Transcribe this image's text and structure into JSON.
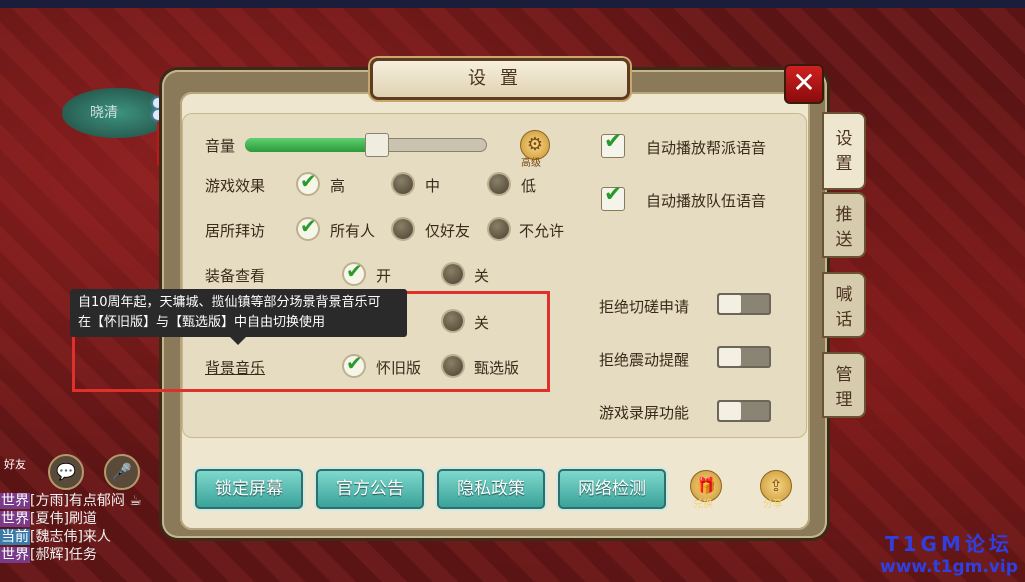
{
  "dialog": {
    "title": "设置",
    "close_label": "✕"
  },
  "left_map_label": "晓清",
  "tabs": [
    {
      "label_top": "设",
      "label_bottom": "置"
    },
    {
      "label_top": "推",
      "label_bottom": "送"
    },
    {
      "label_top": "喊",
      "label_bottom": "话"
    },
    {
      "label_top": "管",
      "label_bottom": "理"
    }
  ],
  "settings": {
    "volume": {
      "label": "音量",
      "level": 0.54
    },
    "advanced": {
      "label": "高级"
    },
    "game_effect": {
      "label": "游戏效果",
      "options": [
        "高",
        "中",
        "低"
      ],
      "selected": "高"
    },
    "home_visit": {
      "label": "居所拜访",
      "options": [
        "所有人",
        "仅好友",
        "不允许"
      ],
      "selected": "所有人"
    },
    "equipment_view": {
      "label": "装备查看",
      "options": [
        "开",
        "关"
      ],
      "selected": "开"
    },
    "hidden_row": {
      "options": [
        "开",
        "关"
      ],
      "selected": "开"
    },
    "bgm": {
      "label": "背景音乐",
      "options": [
        "怀旧版",
        "甄选版"
      ],
      "selected": "怀旧版"
    }
  },
  "right_settings": {
    "auto_guild_voice": {
      "label": "自动播放帮派语音",
      "checked": true
    },
    "auto_team_voice": {
      "label": "自动播放队伍语音",
      "checked": true
    },
    "reject_duel": {
      "label": "拒绝切磋申请",
      "on": false
    },
    "reject_vibrate": {
      "label": "拒绝震动提醒",
      "on": false
    },
    "screen_record": {
      "label": "游戏录屏功能",
      "on": false
    }
  },
  "tooltip": {
    "line1": "自10周年起，天墉城、揽仙镇等部分场景背景音乐可",
    "line2": "在【怀旧版】与【甄选版】中自由切换使用"
  },
  "bottom_buttons": [
    "锁定屏幕",
    "官方公告",
    "隐私政策",
    "网络检测"
  ],
  "extra_buttons": [
    {
      "label": "兑换"
    },
    {
      "label": "分享"
    }
  ],
  "chat": {
    "friend_label": "好友",
    "lines": [
      {
        "channel": "世界",
        "text": "[方雨]有点郁闷 ☕"
      },
      {
        "channel": "世界",
        "text": "[夏伟]刷道"
      },
      {
        "channel": "当前",
        "text": "[魏志伟]来人"
      },
      {
        "channel": "世界",
        "text": "[郝辉]任务"
      }
    ]
  },
  "watermark": {
    "line1": "T1GM论坛",
    "line2": "www.t1gm.vip"
  },
  "colors": {
    "accent_green": "#2a9a2a",
    "teal_button": "#3aa39a",
    "close_red": "#d02020",
    "highlight_red": "#e0302a"
  }
}
